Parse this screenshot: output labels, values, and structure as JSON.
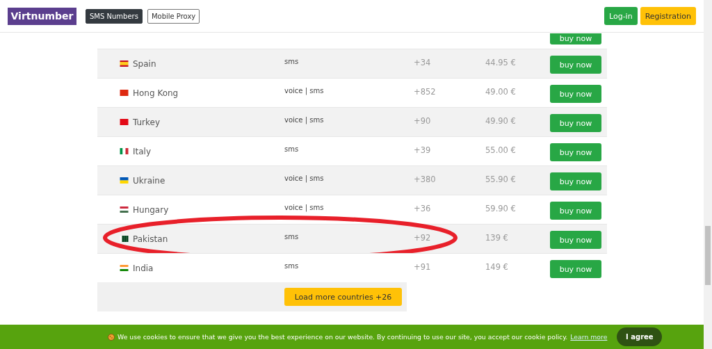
{
  "header": {
    "logo": "Virtnumber",
    "nav": [
      {
        "label": "SMS Numbers",
        "selected": true
      },
      {
        "label": "Mobile Proxy",
        "selected": false
      }
    ],
    "login": "Log-in",
    "register": "Registration"
  },
  "partial_row": {
    "button": "buy now"
  },
  "rows": [
    {
      "country": "Spain",
      "type": "sms",
      "code": "+34",
      "price": "44.95 €",
      "button": "buy now",
      "circled": false
    },
    {
      "country": "Hong Kong",
      "type": "voice | sms",
      "code": "+852",
      "price": "49.00 €",
      "button": "buy now",
      "circled": false
    },
    {
      "country": "Turkey",
      "type": "voice | sms",
      "code": "+90",
      "price": "49.90 €",
      "button": "buy now",
      "circled": false
    },
    {
      "country": "Italy",
      "type": "sms",
      "code": "+39",
      "price": "55.00 €",
      "button": "buy now",
      "circled": false
    },
    {
      "country": "Ukraine",
      "type": "voice | sms",
      "code": "+380",
      "price": "55.90 €",
      "button": "buy now",
      "circled": false
    },
    {
      "country": "Hungary",
      "type": "voice | sms",
      "code": "+36",
      "price": "59.90 €",
      "button": "buy now",
      "circled": false
    },
    {
      "country": "Pakistan",
      "type": "sms",
      "code": "+92",
      "price": "139 €",
      "button": "buy now",
      "circled": true
    },
    {
      "country": "India",
      "type": "sms",
      "code": "+91",
      "price": "149 €",
      "button": "buy now",
      "circled": false
    }
  ],
  "load_more": "Load more countries +26",
  "cookie_bar": {
    "text": "We use cookies to ensure that we give you the best experience on our website. By continuing to use our site, you accept our cookie policy.",
    "link": "Learn more",
    "button": "I agree"
  }
}
